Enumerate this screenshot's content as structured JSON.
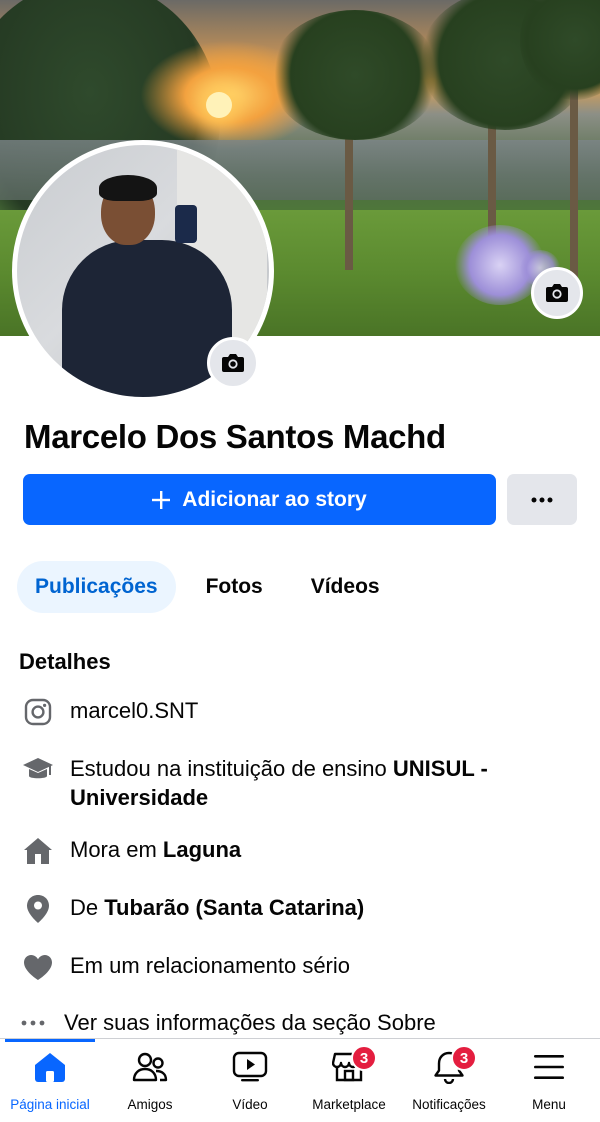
{
  "profile": {
    "name": "Marcelo Dos Santos Machd"
  },
  "actions": {
    "add_story_label": "Adicionar ao story",
    "more_label": "···"
  },
  "tabs": [
    {
      "label": "Publicações",
      "active": true
    },
    {
      "label": "Fotos",
      "active": false
    },
    {
      "label": "Vídeos",
      "active": false
    }
  ],
  "details": {
    "title": "Detalhes",
    "instagram": "marcel0.SNT",
    "education_prefix": "Estudou na instituição de ensino ",
    "education_school": "UNISUL - Universidade",
    "lives_prefix": "Mora em ",
    "lives_city": "Laguna",
    "from_prefix": "De ",
    "from_city": "Tubarão (Santa Catarina)",
    "relationship": "Em um relacionamento sério",
    "see_more": "Ver suas informações da seção Sobre"
  },
  "bottom_nav": {
    "home": "Página inicial",
    "friends": "Amigos",
    "video": "Vídeo",
    "marketplace": "Marketplace",
    "marketplace_badge": "3",
    "notifications": "Notificações",
    "notifications_badge": "3",
    "menu": "Menu"
  },
  "colors": {
    "accent": "#0866ff",
    "link": "#0064d1",
    "badge": "#e41e3f",
    "secondary_button": "#e4e6eb"
  },
  "icons": {
    "cover_camera": "camera-icon",
    "avatar_camera": "camera-icon",
    "instagram": "instagram-icon",
    "education": "graduation-cap-icon",
    "home": "house-icon",
    "location": "location-pin-icon",
    "relationship": "heart-icon"
  }
}
